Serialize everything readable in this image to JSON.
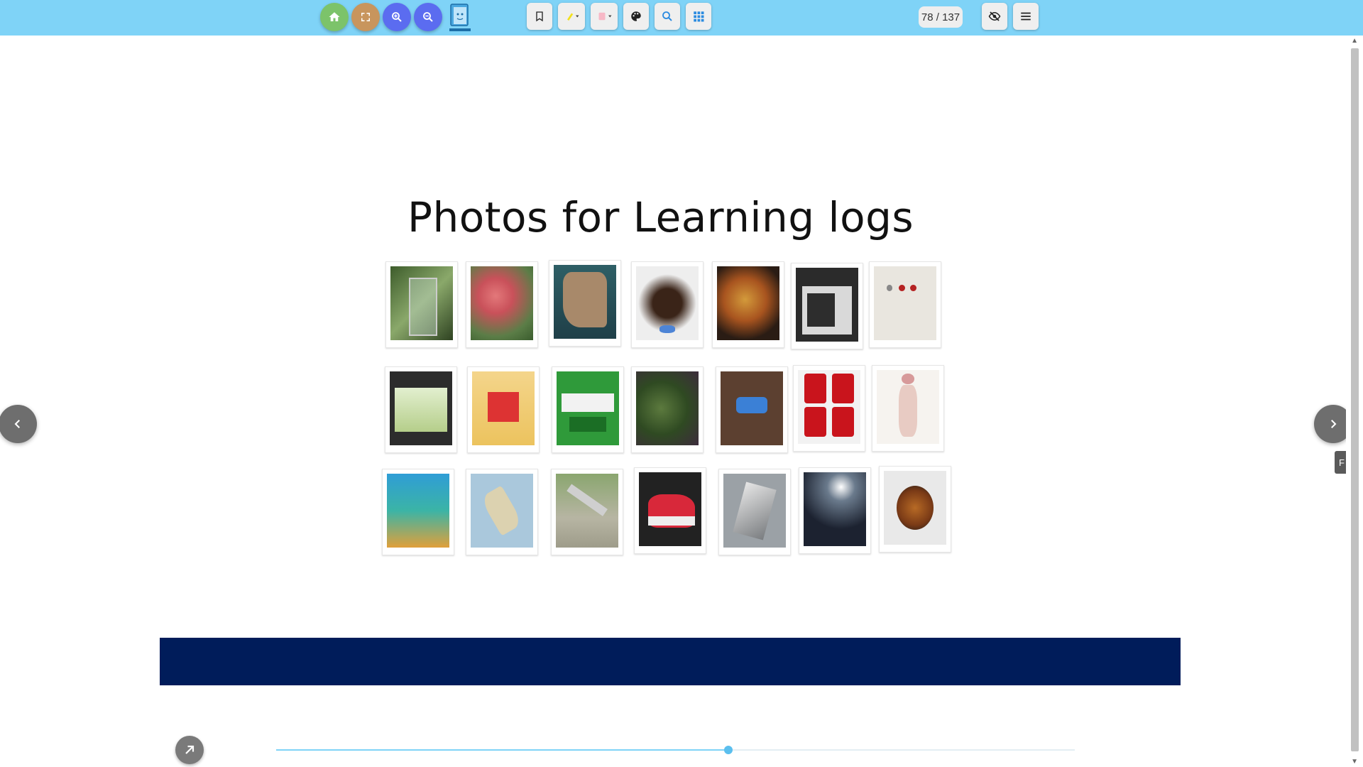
{
  "toolbar": {
    "page_counter": "78 / 137",
    "buttons": {
      "home": "home-icon",
      "fullscreen": "fullscreen-icon",
      "zoom_in": "zoom-in-icon",
      "zoom_out": "zoom-out-icon",
      "bookmark": "bookmark-icon",
      "highlighter": "highlighter-icon",
      "sticky_note": "sticky-note-icon",
      "palette": "palette-icon",
      "search": "search-icon",
      "grid": "grid-icon",
      "hide": "eye-off-icon",
      "menu": "menu-icon"
    },
    "colors": {
      "bar": "#7fd3f7",
      "home": "#7cc36a",
      "fullscreen": "#c8955d",
      "zoom": "#5b6cf0"
    }
  },
  "page": {
    "title": "Photos for Learning logs",
    "photos": [
      {
        "subject": "bus stop sign among trees"
      },
      {
        "subject": "red autumn leaves"
      },
      {
        "subject": "boot-shaped ornament"
      },
      {
        "subject": "dachshund puppy"
      },
      {
        "subject": "curry and naan plate"
      },
      {
        "subject": "microwave oven"
      },
      {
        "subject": "white machine with red buttons"
      },
      {
        "subject": "tissue box"
      },
      {
        "subject": "flour bag"
      },
      {
        "subject": "green contest poster"
      },
      {
        "subject": "plant leaves"
      },
      {
        "subject": "blue usb hub"
      },
      {
        "subject": "coca-cola cans"
      },
      {
        "subject": "human anatomy chart"
      },
      {
        "subject": "snack package"
      },
      {
        "subject": "map of japan"
      },
      {
        "subject": "playground slide"
      },
      {
        "subject": "red sneakers"
      },
      {
        "subject": "paper crane"
      },
      {
        "subject": "festival at night"
      },
      {
        "subject": "bowl of noodles"
      }
    ],
    "banner_color": "#001c5a"
  },
  "nav": {
    "prev": "chevron-left-icon",
    "next": "chevron-right-icon",
    "side_tab_label": "F"
  },
  "slider": {
    "progress": 0.566
  },
  "share": "arrow-up-right-icon"
}
